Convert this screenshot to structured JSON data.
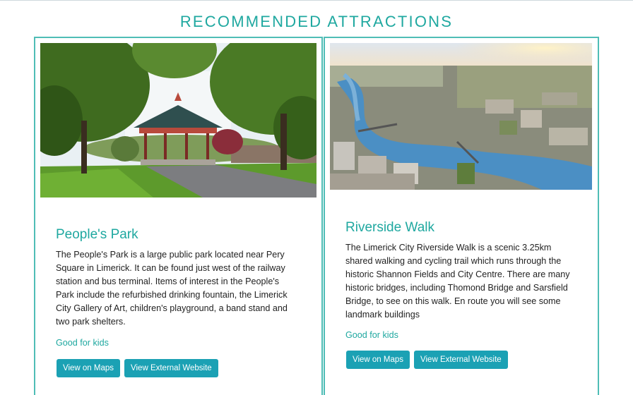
{
  "page": {
    "title": "RECOMMENDED ATTRACTIONS"
  },
  "attractions": [
    {
      "name": "People's Park",
      "description": "The People's Park is a large public park located near Pery Square in Limerick. It can be found just west of the railway station and bus terminal. Items of interest in the People's Park include the refurbished drinking fountain, the Limerick City Gallery of Art, children's playground, a band stand and two park shelters.",
      "tag": "Good for kids",
      "maps_label": "View on Maps",
      "website_label": "View External Website"
    },
    {
      "name": "Riverside Walk",
      "description": "The Limerick City Riverside Walk is a scenic 3.25km shared walking and cycling trail which runs through the historic Shannon Fields and City Centre. There are many historic bridges, including Thomond Bridge and Sarsfield Bridge, to see on this walk. En route you will see some landmark buildings",
      "tag": "Good for kids",
      "maps_label": "View on Maps",
      "website_label": "View External Website"
    }
  ],
  "colors": {
    "accent": "#1fa8a0",
    "border": "#4fbdb6",
    "button": "#1ba1b4"
  }
}
